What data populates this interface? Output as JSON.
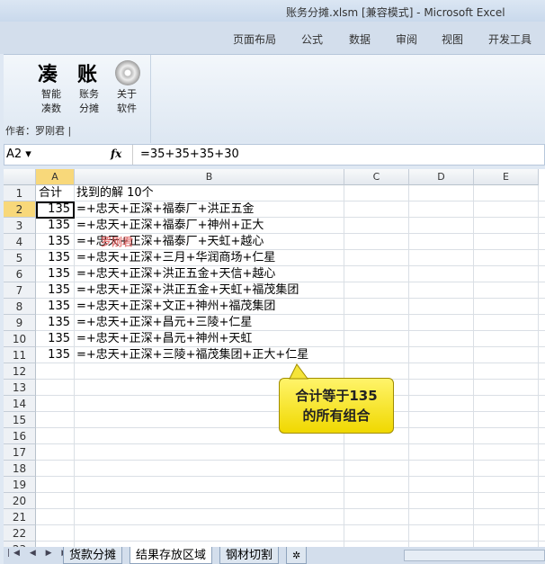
{
  "window": {
    "title": "账务分摊.xlsm  [兼容模式]  -  Microsoft Excel"
  },
  "ribbon_tabs": [
    "页面布局",
    "公式",
    "数据",
    "审阅",
    "视图",
    "开发工具"
  ],
  "ribbon": {
    "logo_left": "凑",
    "logo_right": "账",
    "buttons": [
      {
        "line1": "智能",
        "line2": "凑数"
      },
      {
        "line1": "账务",
        "line2": "分摊"
      },
      {
        "line1": "关于",
        "line2": "软件"
      }
    ],
    "author": "作者：罗刚君 |"
  },
  "formula_bar": {
    "name_box": "A2 ▾",
    "fx": "fx",
    "formula": "=35+35+35+30"
  },
  "columns": [
    "A",
    "B",
    "C",
    "D",
    "E"
  ],
  "rows": [
    {
      "a": "合计",
      "b": "找到的解  10个"
    },
    {
      "a": "135",
      "b": "=+忠天+正深+福泰厂+洪正五金"
    },
    {
      "a": "135",
      "b": "=+忠天+正深+福泰厂+神州+正大"
    },
    {
      "a": "135",
      "b": "=+忠天+正深+福泰厂+天虹+越心"
    },
    {
      "a": "135",
      "b": "=+忠天+正深+三月+华润商场+仁星"
    },
    {
      "a": "135",
      "b": "=+忠天+正深+洪正五金+天信+越心"
    },
    {
      "a": "135",
      "b": "=+忠天+正深+洪正五金+天虹+福茂集团"
    },
    {
      "a": "135",
      "b": "=+忠天+正深+文正+神州+福茂集团"
    },
    {
      "a": "135",
      "b": "=+忠天+正深+昌元+三陵+仁星"
    },
    {
      "a": "135",
      "b": "=+忠天+正深+昌元+神州+天虹"
    },
    {
      "a": "135",
      "b": "=+忠天+正深+三陵+福茂集团+正大+仁星"
    }
  ],
  "row_count": 23,
  "watermark": "罗刚君",
  "callout": {
    "line1": "合计等于135",
    "line2": "的所有组合"
  },
  "sheet_tabs": [
    "货款分摊",
    "结果存放区域",
    "钢材切割"
  ]
}
